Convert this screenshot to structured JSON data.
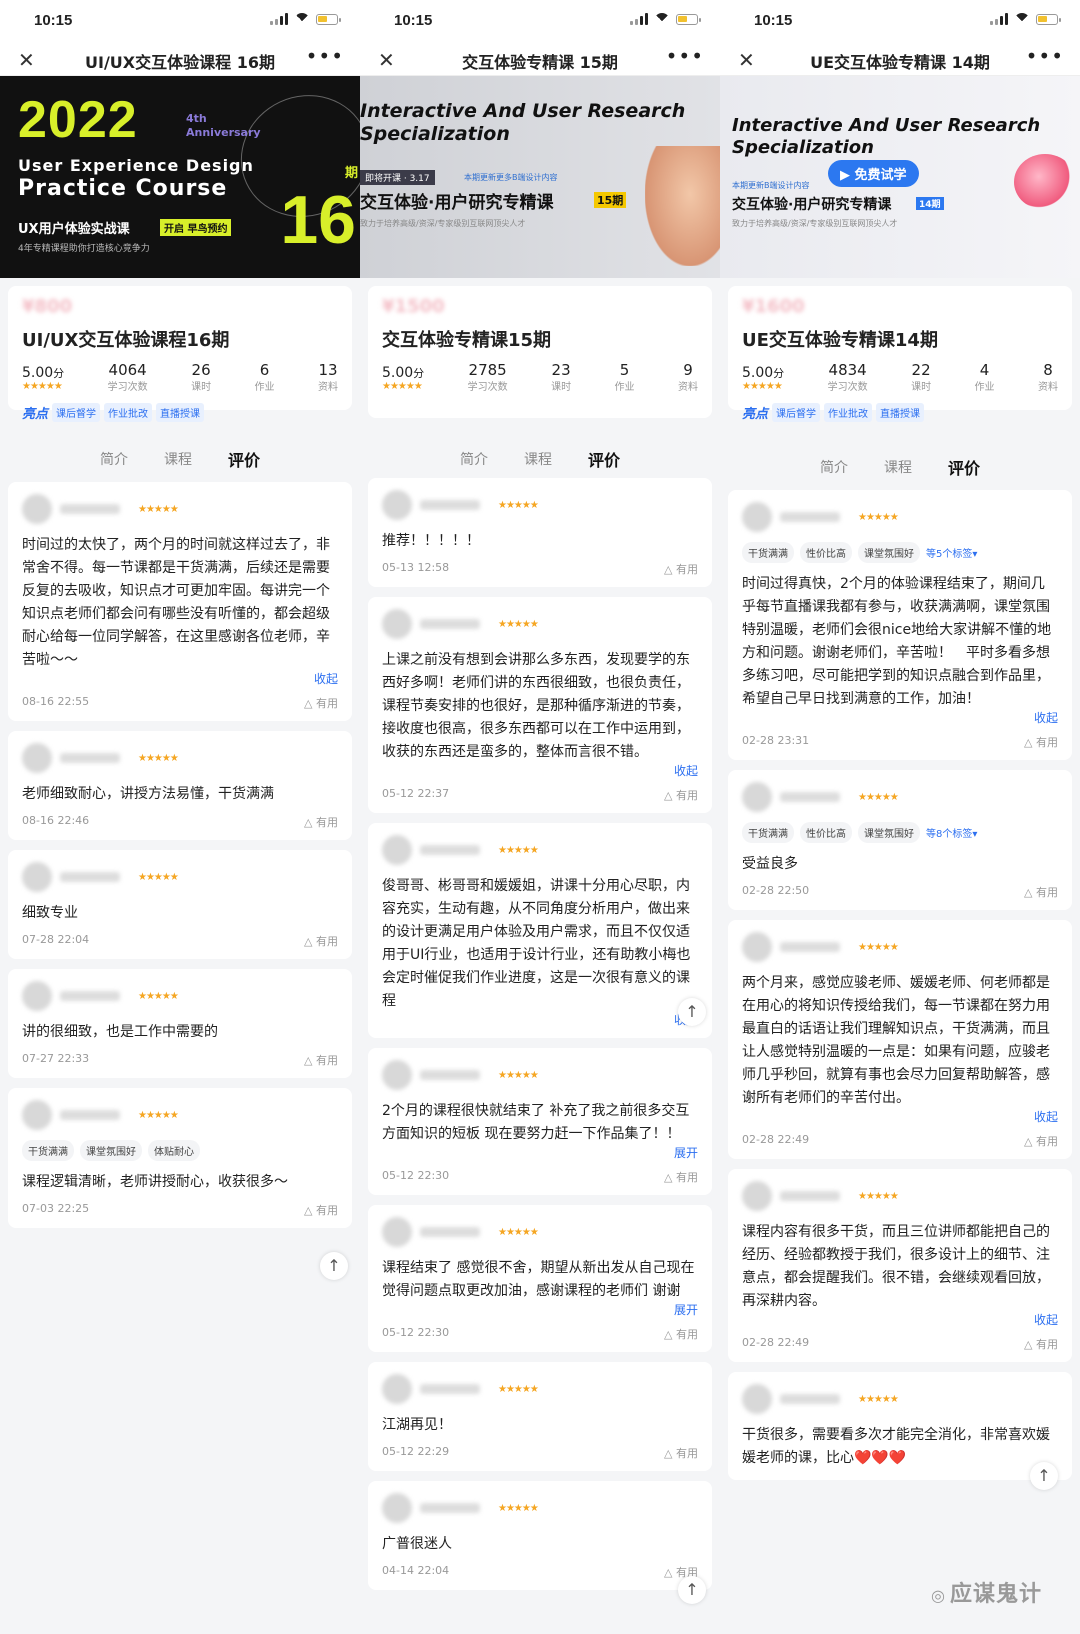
{
  "phones": [
    {
      "time": "10:15",
      "nav_title": "UI/UX交互体验课程 16期",
      "banner": {
        "year": "2022",
        "anniv": "4th\nAnniversary",
        "en1": "User Experience Design",
        "en2": "Practice Course",
        "qi": "期",
        "num": "16",
        "cn": "UX用户体验实战课",
        "tag": "开启 早鸟预约",
        "sub": "4年专精课程助你打造核心竞争力"
      },
      "course_title": "UI/UX交互体验课程16期",
      "score": "5.00",
      "score_unit": "分",
      "stats": [
        {
          "n": "4064",
          "l": "学习次数"
        },
        {
          "n": "26",
          "l": "课时"
        },
        {
          "n": "6",
          "l": "作业"
        },
        {
          "n": "13",
          "l": "资料"
        }
      ],
      "highlight": "亮点",
      "highlight_tags": [
        "课后督学",
        "作业批改",
        "直播授课"
      ],
      "tabs": [
        "简介",
        "课程",
        "评价"
      ],
      "reviews": [
        {
          "text": "时间过的太快了，两个月的时间就这样过去了，非常舍不得。每一节课都是干货满满，后续还是需要反复的去吸收，知识点才可更加牢固。每讲完一个知识点老师们都会问有哪些没有听懂的，都会超级耐心给每一位同学解答，在这里感谢各位老师，辛苦啦～～",
          "toggle": "收起",
          "date": "08-16 22:55",
          "useful": "有用",
          "tags": []
        },
        {
          "text": "老师细致耐心，讲授方法易懂，干货满满",
          "date": "08-16 22:46",
          "useful": "有用",
          "tags": []
        },
        {
          "text": "细致专业",
          "date": "07-28 22:04",
          "useful": "有用",
          "tags": []
        },
        {
          "text": "讲的很细致，也是工作中需要的",
          "date": "07-27 22:33",
          "useful": "有用",
          "tags": []
        },
        {
          "text": "课程逻辑清晰，老师讲授耐心，收获很多～",
          "date": "07-03 22:25",
          "useful": "有用",
          "tags": [
            "干货满满",
            "课堂氛围好",
            "体贴耐心"
          ]
        }
      ]
    },
    {
      "time": "10:15",
      "nav_title": "交互体验专精课 15期",
      "banner": {
        "en1": "Interactive And User Research",
        "en2": "Specialization",
        "pill": "即将开课 · 3.17",
        "blue": "本期更新更多B端设计内容",
        "cn": "交互体验·用户研究专精课",
        "qi": "15期",
        "sub": "致力于培养高级/资深/专家级别互联网顶尖人才"
      },
      "course_title": "交互体验专精课15期",
      "score": "5.00",
      "score_unit": "分",
      "stats": [
        {
          "n": "2785",
          "l": "学习次数"
        },
        {
          "n": "23",
          "l": "课时"
        },
        {
          "n": "5",
          "l": "作业"
        },
        {
          "n": "9",
          "l": "资料"
        }
      ],
      "tabs": [
        "简介",
        "课程",
        "评价"
      ],
      "reviews": [
        {
          "text": "推荐！！！！！",
          "date": "05-13 12:58",
          "useful": "有用",
          "tags": []
        },
        {
          "text": "上课之前没有想到会讲那么多东西，发现要学的东西好多啊！老师们讲的东西很细致，也很负责任，课程节奏安排的也很好，是那种循序渐进的节奏，接收度也很高，很多东西都可以在工作中运用到，收获的东西还是蛮多的，整体而言很不错。",
          "toggle": "收起",
          "date": "05-12 22:37",
          "useful": "有用",
          "tags": []
        },
        {
          "text": "俊哥哥、彬哥哥和媛媛姐，讲课十分用心尽职，内容充实，生动有趣，从不同角度分析用户，做出来的设计更满足用户体验及用户需求，而且不仅仅适用于UI行业，也适用于设计行业，还有助教小梅也会定时催促我们作业进度，这是一次很有意义的课程",
          "toggle": "收起",
          "date": "",
          "useful": "",
          "tags": []
        },
        {
          "text": "2个月的课程很快就结束了 补充了我之前很多交互方面知识的短板 现在要努力赶一下作品集了！！",
          "toggle": "展开",
          "clip": true,
          "date": "05-12 22:30",
          "useful": "有用",
          "tags": []
        },
        {
          "text": "课程结束了 感觉很不舍，期望从新出发从自己现在觉得问题点取更改加油，感谢课程的老师们 谢谢",
          "toggle": "展开",
          "clip": true,
          "date": "05-12 22:30",
          "useful": "有用",
          "tags": []
        },
        {
          "text": "江湖再见！",
          "date": "05-12 22:29",
          "useful": "有用",
          "tags": []
        },
        {
          "text": "广普很迷人",
          "date": "04-14 22:04",
          "useful": "有用",
          "tags": []
        }
      ]
    },
    {
      "time": "10:15",
      "nav_title": "UE交互体验专精课 14期",
      "banner": {
        "en1": "Interactive And User Research",
        "en2": "Specialization",
        "try": "免费试学",
        "blue": "本期更新B端设计内容",
        "cn": "交互体验·用户研究专精课",
        "qi": "14期",
        "sub": "致力于培养高级/资深/专家级别互联网顶尖人才"
      },
      "course_title": "UE交互体验专精课14期",
      "score": "5.00",
      "score_unit": "分",
      "stats": [
        {
          "n": "4834",
          "l": "学习次数"
        },
        {
          "n": "22",
          "l": "课时"
        },
        {
          "n": "4",
          "l": "作业"
        },
        {
          "n": "8",
          "l": "资料"
        }
      ],
      "highlight": "亮点",
      "highlight_tags": [
        "课后督学",
        "作业批改",
        "直播授课"
      ],
      "tabs": [
        "简介",
        "课程",
        "评价"
      ],
      "reviews": [
        {
          "text": "时间过得真快，2个月的体验课程结束了，期间几乎每节直播课我都有参与，收获满满啊，课堂氛围特别温暖，老师们会很nice地给大家讲解不懂的地方和问题。谢谢老师们，辛苦啦！　平时多看多想多练习吧，尽可能把学到的知识点融合到作品里，希望自己早日找到满意的工作，加油！",
          "toggle": "收起",
          "date": "02-28 23:31",
          "useful": "有用",
          "tags": [
            "干货满满",
            "性价比高",
            "课堂氛围好"
          ],
          "more_tags": "等5个标签▾"
        },
        {
          "text": "受益良多",
          "date": "02-28 22:50",
          "useful": "有用",
          "tags": [
            "干货满满",
            "性价比高",
            "课堂氛围好"
          ],
          "more_tags": "等8个标签▾"
        },
        {
          "text": "两个月来，感觉应骏老师、媛媛老师、何老师都是在用心的将知识传授给我们，每一节课都在努力用最直白的话语让我们理解知识点，干货满满，而且让人感觉特别温暖的一点是：如果有问题，应骏老师几乎秒回，就算有事也会尽力回复帮助解答，感谢所有老师们的辛苦付出。",
          "toggle": "收起",
          "date": "02-28 22:49",
          "useful": "有用",
          "tags": []
        },
        {
          "text": "课程内容有很多干货，而且三位讲师都能把自己的经历、经验都教授于我们，很多设计上的细节、注意点，都会提醒我们。很不错，会继续观看回放，再深耕内容。",
          "toggle": "收起",
          "date": "02-28 22:49",
          "useful": "有用",
          "tags": []
        },
        {
          "text": "干货很多，需要看多次才能完全消化，非常喜欢媛媛老师的课，比心❤️❤️❤️",
          "date": "",
          "useful": "",
          "tags": []
        }
      ]
    }
  ],
  "watermark": "应谋鬼计"
}
